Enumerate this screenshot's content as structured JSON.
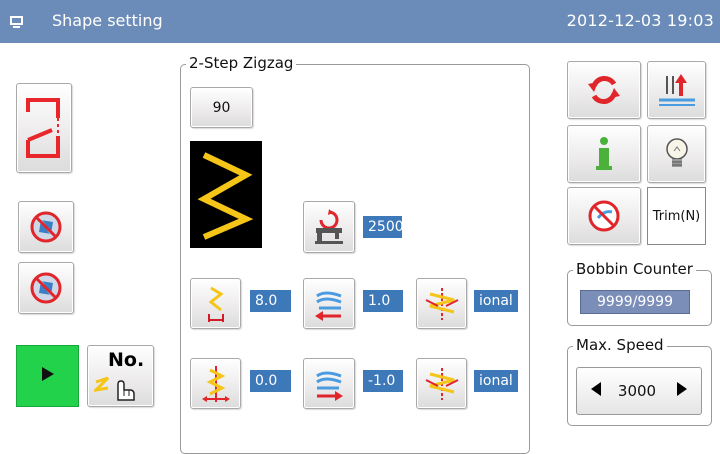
{
  "titlebar": {
    "title": "Shape setting",
    "datetime": "2012-12-03  19:03",
    "background_color": "#6b8cb8"
  },
  "left_panel": {
    "shape_icon": "zigzag-shape-icon",
    "buttons": [
      "no-sewing-disabled-icon",
      "no-sewing-icon",
      "play-icon",
      "number-select-icon"
    ],
    "number_button_label": "No."
  },
  "center_panel": {
    "group_title": "2-Step Zigzag",
    "angle_value": "90",
    "speed_value": "2500",
    "row1": {
      "stitch_value": "8.0",
      "compensation_value": "1.0",
      "mode_value": "ional"
    },
    "row2": {
      "stitch_value": "0.0",
      "compensation_value": "-1.0",
      "mode_value": "ional"
    },
    "accent_color": "#3d78b9",
    "pattern_color": "#f5c518"
  },
  "right_panel": {
    "top_buttons": [
      "cycle-icon",
      "needle-up-icon",
      "info-icon",
      "bulb-icon",
      "no-wiper-icon"
    ],
    "trim_label": "Trim(N)",
    "bobbin_counter": {
      "title": "Bobbin Counter",
      "value": "9999/9999"
    },
    "max_speed": {
      "title": "Max. Speed",
      "value": "3000"
    }
  }
}
